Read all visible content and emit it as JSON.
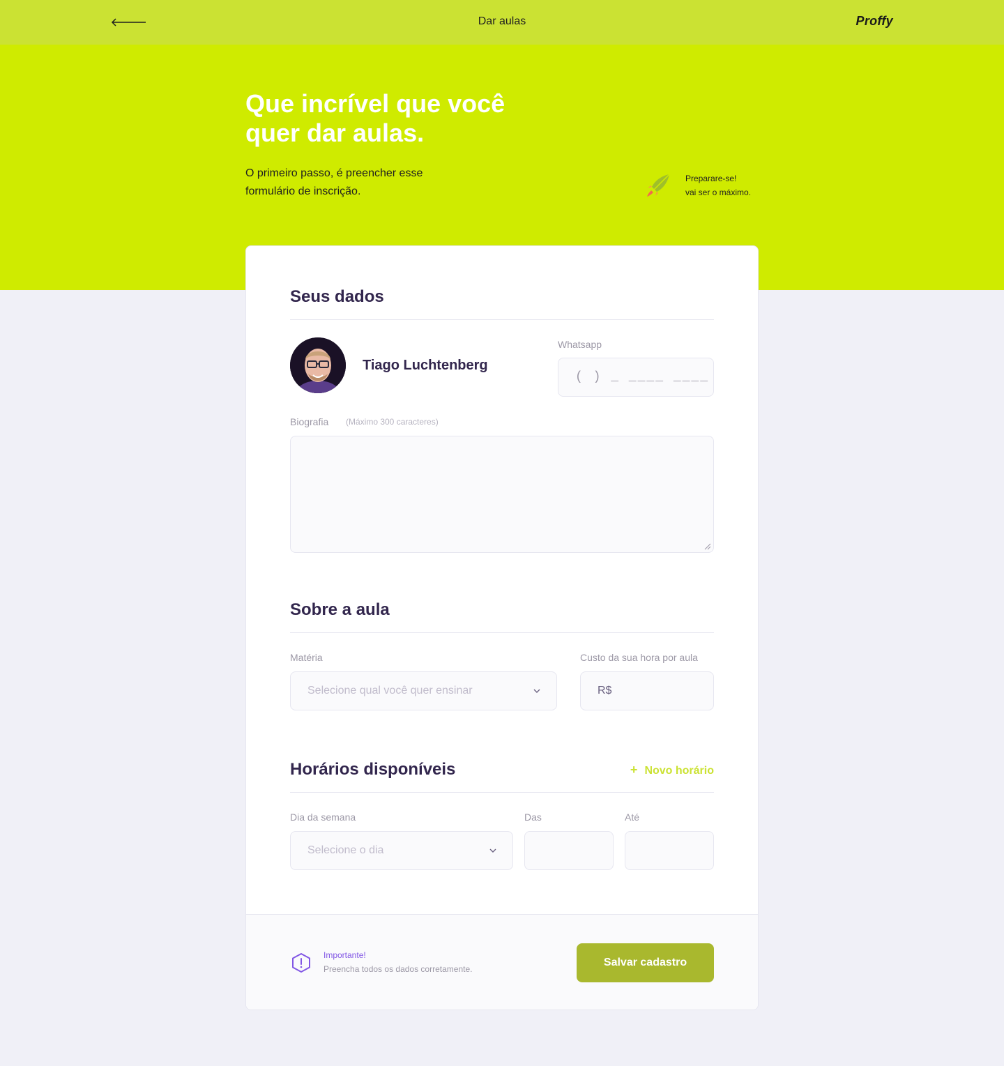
{
  "header": {
    "title": "Dar aulas",
    "logo": "Proffy",
    "back_icon": "arrow-left-icon"
  },
  "hero": {
    "title_line1": "Que incrível que você",
    "title_line2": "quer dar aulas.",
    "desc_line1": "O primeiro passo, é preencher esse",
    "desc_line2": "formulário de inscrição.",
    "tip_line1": "Preparare-se!",
    "tip_line2": "vai ser o máximo.",
    "tip_icon": "rocket-icon"
  },
  "profile": {
    "section_title": "Seus dados",
    "name": "Tiago Luchtenberg",
    "whatsapp_label": "Whatsapp",
    "whatsapp_mask": "( ) _ ____ ____",
    "bio_label": "Biografia",
    "bio_hint": "(Máximo 300 caracteres)",
    "bio_value": ""
  },
  "class_info": {
    "section_title": "Sobre a aula",
    "subject_label": "Matéria",
    "subject_placeholder": "Selecione qual você quer ensinar",
    "cost_label": "Custo da sua hora por aula",
    "cost_prefix": "R$"
  },
  "schedule": {
    "section_title": "Horários disponíveis",
    "new_slot_plus": "+",
    "new_slot_label": "Novo horário",
    "day_label": "Dia da semana",
    "day_placeholder": "Selecione o dia",
    "from_label": "Das",
    "to_label": "Até",
    "from_value": "",
    "to_value": ""
  },
  "footer": {
    "warning_icon": "alert-hexagon-icon",
    "warning_title": "Importante!",
    "warning_text": "Preencha todos os dados corretamente.",
    "save_label": "Salvar cadastro"
  },
  "colors": {
    "topbar": "#cbe233",
    "hero": "#cfeb00",
    "accent_purple": "#8257e5",
    "save_button": "#a9b82e",
    "page_bg": "#f0f0f7"
  }
}
